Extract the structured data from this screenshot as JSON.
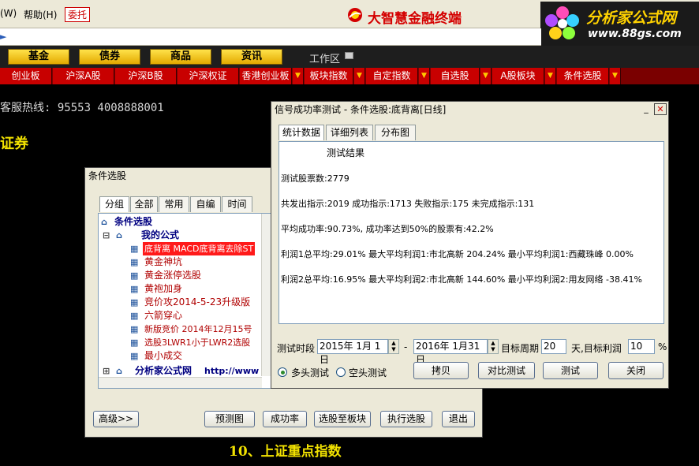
{
  "menu": {
    "w": "(W)",
    "help": "帮助(H)",
    "entrust": "委托"
  },
  "brand": {
    "name": "大智慧金融终端"
  },
  "site": {
    "name": "分析家公式网",
    "url": "www.88gs.com"
  },
  "categories": [
    "基金",
    "债券",
    "商品",
    "资讯"
  ],
  "workspace": "工作区",
  "tabs": [
    "创业板",
    "沪深A股",
    "沪深B股",
    "沪深权证",
    "香港创业板",
    "板块指数",
    "自定指数",
    "自选股",
    "A股板块",
    "条件选股"
  ],
  "main": {
    "hotline": "客服热线: 95553 4008888001",
    "securities": "证券",
    "bottom_title": "10、上证重点指数"
  },
  "cond_window": {
    "title": "条件选股",
    "tabs": [
      "分组",
      "全部",
      "常用",
      "自编",
      "时间"
    ],
    "tree_root": "条件选股",
    "my_formula": "我的公式",
    "items": [
      "底背离 MACD底背离去除ST",
      "黄金神坑",
      "黄金涨停选股",
      "黄袍加身",
      "竞价攻2014-5-23升级版",
      "六箭穿心",
      "新版竞价 2014年12月15号",
      "选股3LWR1小于LWR2选股",
      "最小成交"
    ],
    "site_node": "分析家公式网",
    "site_url": "http://www",
    "advanced_button": "高级>>",
    "predict_button": "预测图",
    "success_button": "成功率",
    "to_block_button": "选股至板块",
    "run_button": "执行选股",
    "exit_button": "退出"
  },
  "test_window": {
    "title": "信号成功率测试 - 条件选股:底背离[日线]",
    "tabs": [
      "统计数据",
      "详细列表",
      "分布图"
    ],
    "result_heading": "测试结果",
    "lines": [
      "测试股票数:2779",
      "共发出指示:2019 成功指示:1713 失败指示:175 未完成指示:131",
      "平均成功率:90.73%, 成功率达到50%的股票有:42.2%",
      "利润1总平均:29.01% 最大平均利润1:市北高新 204.24% 最小平均利润1:西藏珠峰 0.00%",
      "利润2总平均:16.95% 最大平均利润2:市北高新 144.60% 最小平均利润2:用友网络 -38.41%"
    ],
    "period_label": "测试时段",
    "start_date": "2015年 1月 1日",
    "dash": "-",
    "end_date": "2016年 1月31日",
    "target_period_label": "目标周期",
    "target_period_value": "20",
    "target_profit_label": "天,目标利润",
    "target_profit_value": "10",
    "percent": "%",
    "long_test": "多头测试",
    "short_test": "空头测试",
    "copy_button": "拷贝",
    "compare_button": "对比测试",
    "test_button": "测试",
    "close_button": "关闭"
  },
  "colors": {
    "tab_red": "#c80000",
    "gold": "#f2e200",
    "selected_bg": "#ff1a1a"
  }
}
